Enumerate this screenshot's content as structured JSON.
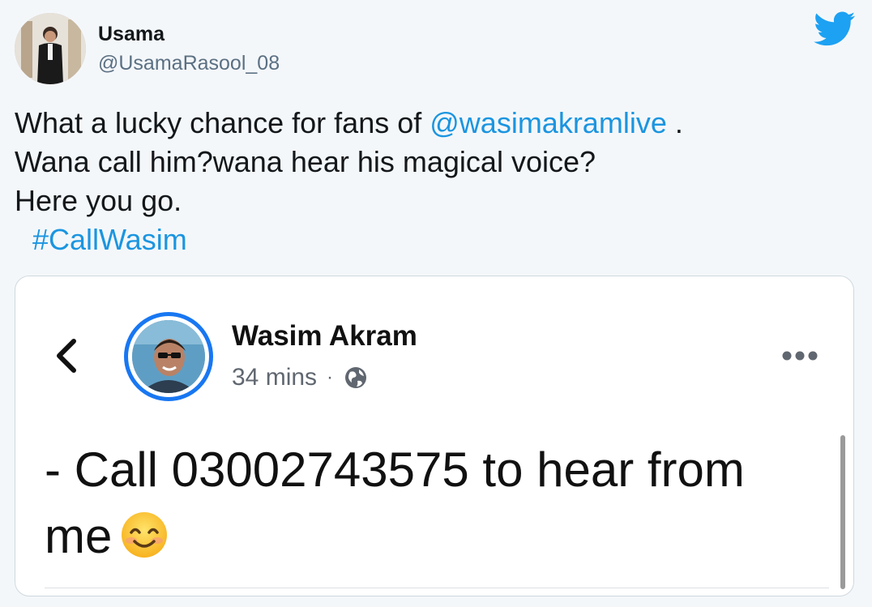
{
  "tweet": {
    "author_name": "Usama",
    "author_handle": "@UsamaRasool_08",
    "text_line1_prefix": "What a lucky chance for fans of ",
    "mention": "@wasimakramlive",
    "text_line1_suffix": " .",
    "text_line2": "Wana call him?wana hear his magical voice?",
    "text_line3": "Here you go.",
    "hashtag": "#CallWasim",
    "icons": {
      "brand": "twitter-bird-icon"
    },
    "colors": {
      "link": "#1b95e0",
      "twitter_blue": "#1da1f2"
    }
  },
  "embedded_post": {
    "author_name": "Wasim Akram",
    "time": "34 mins",
    "separator": "·",
    "text": "- Call 03002743575 to hear from me",
    "icons": {
      "back": "chevron-left-icon",
      "privacy": "globe-icon",
      "more": "more-dots-icon",
      "emoji": "smiling-face-emoji"
    },
    "colors": {
      "avatar_ring": "#1877f2"
    }
  }
}
